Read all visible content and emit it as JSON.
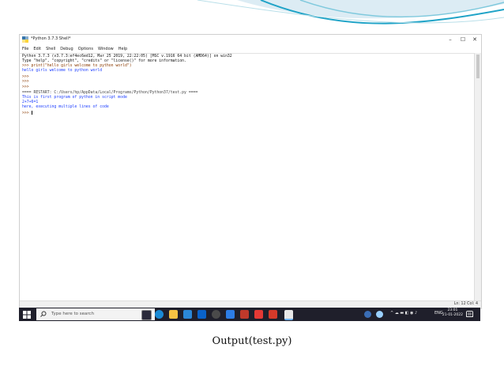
{
  "window": {
    "title": "*Python 3.7.3 Shell*",
    "minimize": "–",
    "maximize": "☐",
    "close": "✕"
  },
  "menu": [
    "File",
    "Edit",
    "Shell",
    "Debug",
    "Options",
    "Window",
    "Help"
  ],
  "shell_lines": [
    {
      "text": "Python 3.7.3 (v3.7.3:ef4ec6ed12, Mar 25 2019, 22:22:05) [MSC v.1916 64 bit (AMD64)] on win32",
      "kind": "out"
    },
    {
      "text": "Type \"help\", \"copyright\", \"credits\" or \"license()\" for more information.",
      "kind": "out"
    },
    {
      "text": ">>> print(\"hello girls welcome to python world\")",
      "kind": "prompt"
    },
    {
      "text": "hello girls welcome to python world",
      "kind": "stdout"
    },
    {
      "text": ">>>",
      "kind": "prompt"
    },
    {
      "text": ">>>",
      "kind": "prompt"
    },
    {
      "text": ">>>",
      "kind": "prompt"
    },
    {
      "text": "==== RESTART: C:/Users/hp/AppData/Local/Programs/Python/Python37/test.py ====",
      "kind": "restart"
    },
    {
      "text": "This is first program of python in script mode",
      "kind": "stdout"
    },
    {
      "text": "2+7+6=1",
      "kind": "stdout"
    },
    {
      "text": "here, executing multiple lines of code",
      "kind": "stdout"
    },
    {
      "text": ">>> ",
      "kind": "prompt"
    }
  ],
  "status": "Ln: 12  Col: 4",
  "taskbar": {
    "search_placeholder": "Type here to search",
    "tray_lang": "ENG",
    "time": "23:01",
    "date": "21-01-2022"
  },
  "caption": "Output(test.py)",
  "colors": {
    "taskbar": "#1f1f2b",
    "stdout": "#1a3cff",
    "prompt": "#8a3a00",
    "swoosh": "#1fa3c7"
  }
}
